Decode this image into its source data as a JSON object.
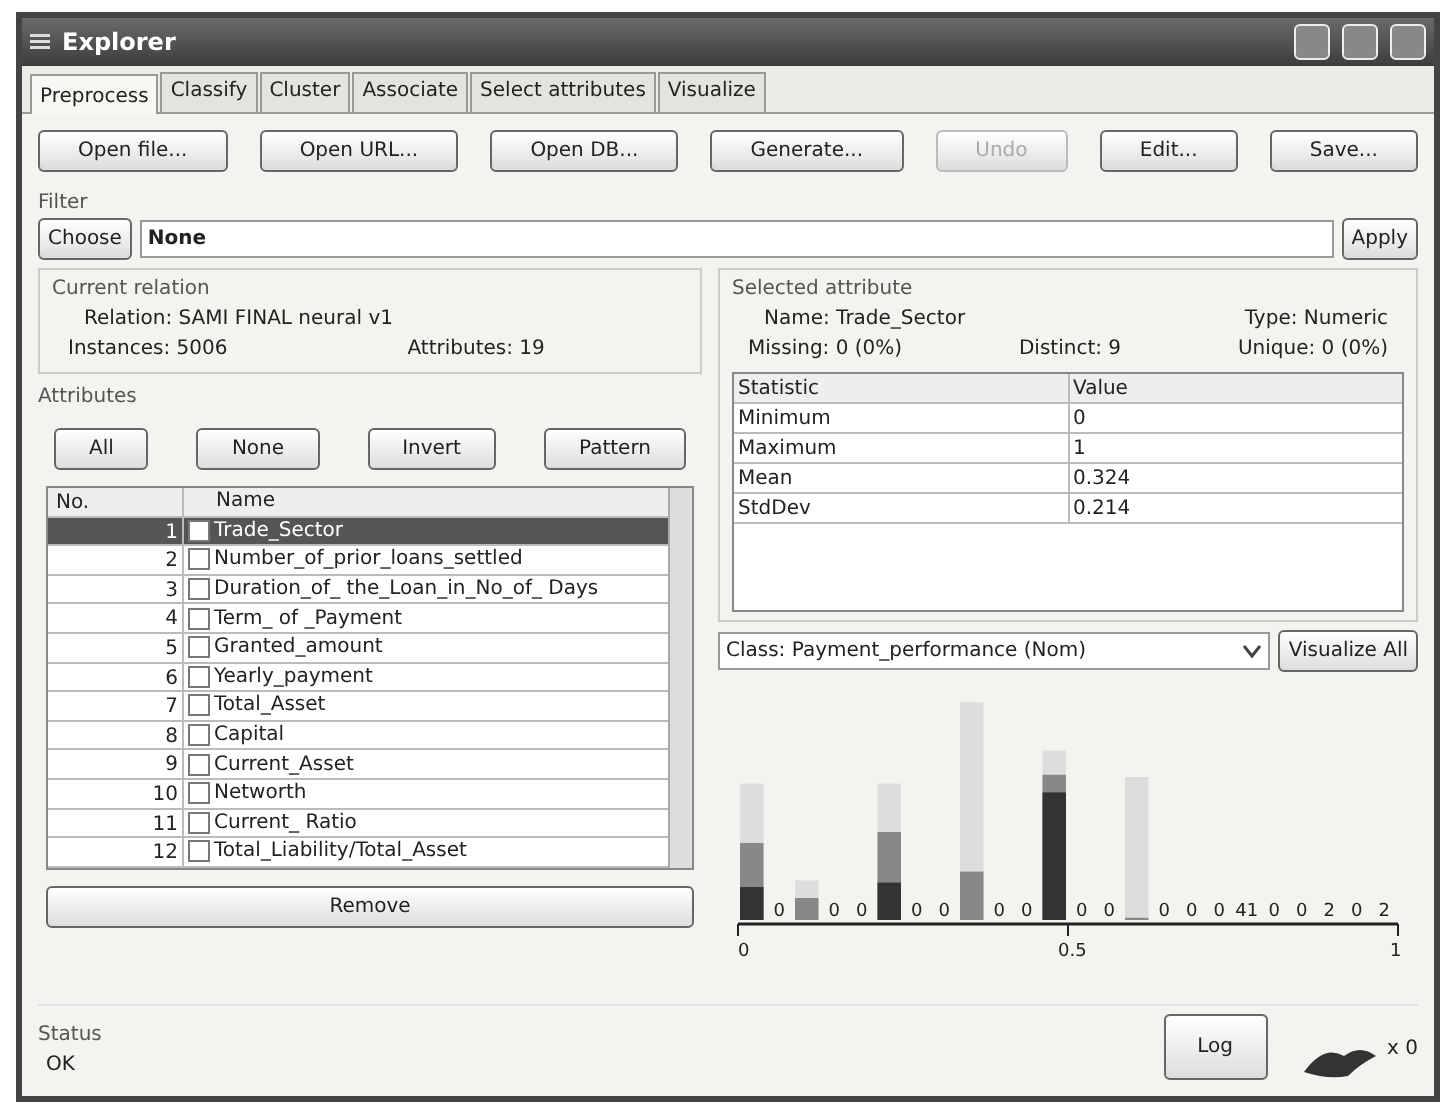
{
  "window": {
    "title": "Explorer"
  },
  "tabs": [
    {
      "label": "Preprocess",
      "selected": true
    },
    {
      "label": "Classify",
      "selected": false
    },
    {
      "label": "Cluster",
      "selected": false
    },
    {
      "label": "Associate",
      "selected": false
    },
    {
      "label": "Select attributes",
      "selected": false
    },
    {
      "label": "Visualize",
      "selected": false
    }
  ],
  "toolbar": [
    {
      "label": "Open file...",
      "disabled": false
    },
    {
      "label": "Open URL...",
      "disabled": false
    },
    {
      "label": "Open DB...",
      "disabled": false
    },
    {
      "label": "Generate...",
      "disabled": false
    },
    {
      "label": "Undo",
      "disabled": true
    },
    {
      "label": "Edit...",
      "disabled": false
    },
    {
      "label": "Save...",
      "disabled": false
    }
  ],
  "filter": {
    "title": "Filter",
    "choose": "Choose",
    "value": "None",
    "apply": "Apply"
  },
  "current_relation": {
    "title": "Current relation",
    "relation": "Relation: SAMI FINAL neural v1",
    "instances": "Instances: 5006",
    "attributes": "Attributes: 19"
  },
  "attributes": {
    "title": "Attributes",
    "buttons": [
      "All",
      "None",
      "Invert",
      "Pattern"
    ],
    "columns": [
      "No.",
      "Name"
    ],
    "rows": [
      {
        "no": "1",
        "name": "Trade_Sector",
        "checked": false,
        "selected": true
      },
      {
        "no": "2",
        "name": "Number_of_prior_loans_settled",
        "checked": false,
        "selected": false
      },
      {
        "no": "3",
        "name": "Duration_of_ the_Loan_in_No_of_ Days",
        "checked": false,
        "selected": false
      },
      {
        "no": "4",
        "name": "Term_ of _Payment",
        "checked": false,
        "selected": false
      },
      {
        "no": "5",
        "name": "Granted_amount",
        "checked": false,
        "selected": false
      },
      {
        "no": "6",
        "name": "Yearly_payment",
        "checked": false,
        "selected": false
      },
      {
        "no": "7",
        "name": "Total_Asset",
        "checked": false,
        "selected": false
      },
      {
        "no": "8",
        "name": "Capital",
        "checked": false,
        "selected": false
      },
      {
        "no": "9",
        "name": "Current_Asset",
        "checked": false,
        "selected": false
      },
      {
        "no": "10",
        "name": "Networth",
        "checked": false,
        "selected": false
      },
      {
        "no": "11",
        "name": "Current_ Ratio",
        "checked": false,
        "selected": false
      },
      {
        "no": "12",
        "name": "Total_Liability/Total_Asset",
        "checked": false,
        "selected": false
      }
    ],
    "remove": "Remove"
  },
  "selected_attribute": {
    "title": "Selected attribute",
    "name": "Name: Trade_Sector",
    "type": "Type: Numeric",
    "missing": "Missing: 0 (0%)",
    "distinct": "Distinct: 9",
    "unique": "Unique: 0 (0%)",
    "columns": [
      "Statistic",
      "Value"
    ],
    "rows": [
      [
        "Minimum",
        "0"
      ],
      [
        "Maximum",
        "1"
      ],
      [
        "Mean",
        "0.324"
      ],
      [
        "StdDev",
        "0.214"
      ]
    ]
  },
  "class_select": {
    "value": "Class: Payment_performance (Nom)",
    "button": "Visualize All"
  },
  "histogram": {
    "labels": [
      "0",
      "0",
      "0",
      "0",
      "0",
      "0",
      "0",
      "0",
      "0",
      "0",
      "0",
      "0",
      "41",
      "0",
      "0",
      "2",
      "0",
      "2"
    ],
    "ticks": [
      "0",
      "0.5",
      "1"
    ]
  },
  "status": {
    "title": "Status",
    "text": "OK",
    "log": "Log",
    "count": "x 0"
  }
}
